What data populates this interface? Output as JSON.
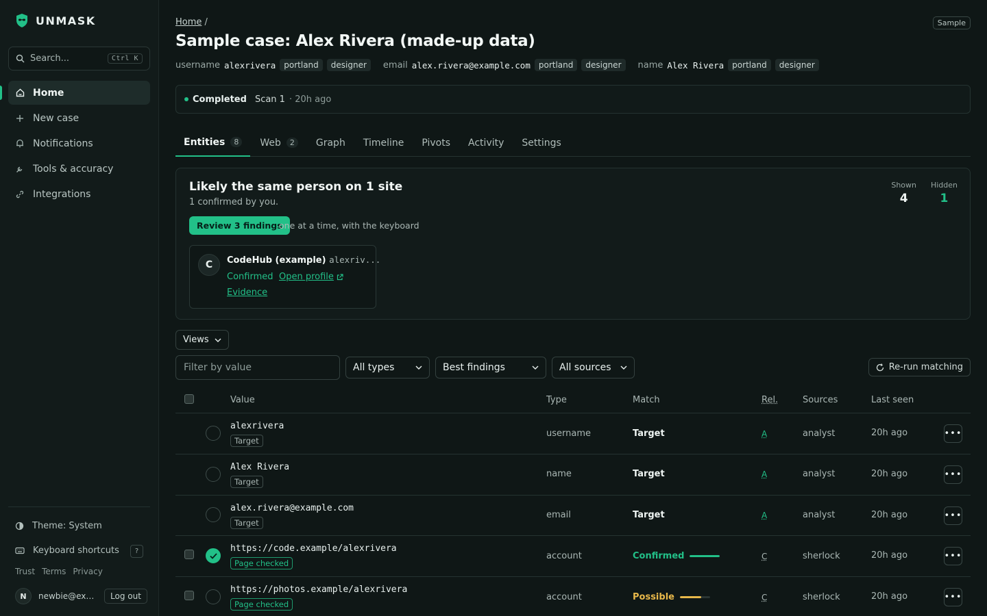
{
  "brand": {
    "name": "UNMASK"
  },
  "search": {
    "placeholder": "Search...",
    "shortcut": "Ctrl K"
  },
  "sidebar": {
    "items": [
      {
        "label": "Home",
        "icon": "home-icon"
      },
      {
        "label": "New case",
        "icon": "plus-icon"
      },
      {
        "label": "Notifications",
        "icon": "bell-icon"
      },
      {
        "label": "Tools & accuracy",
        "icon": "wrench-icon"
      },
      {
        "label": "Integrations",
        "icon": "link-icon"
      }
    ],
    "theme_label": "Theme: System",
    "shortcuts_label": "Keyboard shortcuts",
    "shortcuts_key": "?",
    "links": [
      "Trust",
      "Terms",
      "Privacy"
    ],
    "user": {
      "initial": "N",
      "email": "newbie@example.com",
      "logout": "Log out"
    }
  },
  "header": {
    "breadcrumb_home": "Home",
    "breadcrumb_sep": "/",
    "badge": "Sample",
    "title": "Sample case: Alex Rivera (made-up data)",
    "identifiers": [
      {
        "kind": "username",
        "value": "alexrivera",
        "tags": [
          "portland",
          "designer"
        ]
      },
      {
        "kind": "email",
        "value": "alex.rivera@example.com",
        "tags": [
          "portland",
          "designer"
        ]
      },
      {
        "kind": "name",
        "value": "Alex Rivera",
        "tags": [
          "portland",
          "designer"
        ]
      }
    ]
  },
  "status": {
    "label": "Completed",
    "scan": "Scan 1",
    "time": "· 20h ago",
    "color": "#22c088"
  },
  "tabs": [
    {
      "label": "Entities",
      "count": "8"
    },
    {
      "label": "Web",
      "count": "2"
    },
    {
      "label": "Graph"
    },
    {
      "label": "Timeline"
    },
    {
      "label": "Pivots"
    },
    {
      "label": "Activity"
    },
    {
      "label": "Settings"
    }
  ],
  "summary": {
    "title": "Likely the same person on 1 site",
    "subtitle": "1 confirmed by you.",
    "review_button": "Review 3 findings",
    "review_hint": "one at a time, with the keyboard",
    "shown_label": "Shown",
    "shown_value": "4",
    "hidden_label": "Hidden",
    "hidden_value": "1",
    "profile": {
      "initial": "C",
      "site": "CodeHub (example)",
      "handle": "alexriv...",
      "status": "Confirmed",
      "open_label": "Open profile",
      "evidence_label": "Evidence"
    }
  },
  "toolbar": {
    "views_label": "Views",
    "filter_placeholder": "Filter by value",
    "type_select": "All types",
    "sort_select": "Best findings",
    "source_select": "All sources",
    "rerun_label": "Re-run matching"
  },
  "table": {
    "headers": {
      "value": "Value",
      "type": "Type",
      "match": "Match",
      "rel": "Rel.",
      "sources": "Sources",
      "last_seen": "Last seen"
    },
    "rows": [
      {
        "value": "alexrivera",
        "tag": "Target",
        "type": "username",
        "match": "Target",
        "rel": "A",
        "source": "analyst",
        "last_seen": "20h ago"
      },
      {
        "value": "Alex Rivera",
        "tag": "Target",
        "type": "name",
        "match": "Target",
        "rel": "A",
        "source": "analyst",
        "last_seen": "20h ago"
      },
      {
        "value": "alex.rivera@example.com",
        "tag": "Target",
        "type": "email",
        "match": "Target",
        "rel": "A",
        "source": "analyst",
        "last_seen": "20h ago"
      },
      {
        "value": "https://code.example/alexrivera",
        "tag": "Page checked",
        "type": "account",
        "match": "Confirmed",
        "match_level": 1.0,
        "match_color": "#22c088",
        "rel": "C",
        "source": "sherlock",
        "last_seen": "20h ago"
      },
      {
        "value": "https://photos.example/alexrivera",
        "tag": "Page checked",
        "type": "account",
        "match": "Possible",
        "match_level": 0.7,
        "match_color": "#e8b84a",
        "rel": "C",
        "source": "sherlock",
        "last_seen": "20h ago"
      }
    ]
  },
  "colors": {
    "accent": "#22c088",
    "warning": "#e8b84a",
    "background": "#0f1716"
  }
}
